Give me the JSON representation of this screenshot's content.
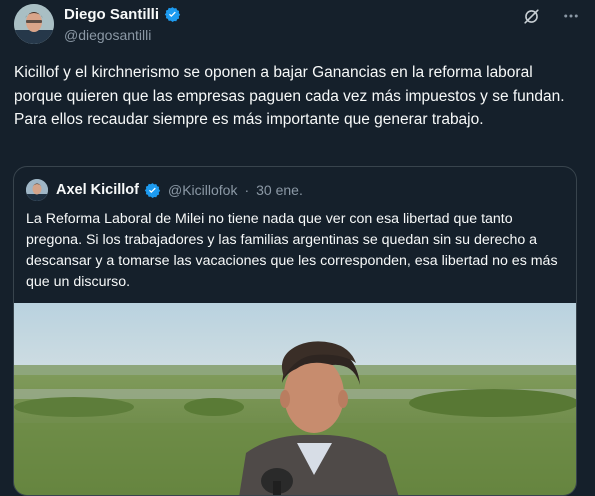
{
  "author": {
    "name": "Diego Santilli",
    "handle": "@diegosantilli"
  },
  "tweet_text": "Kicillof y el kirchnerismo se oponen a bajar Ganancias en la reforma laboral porque quieren que las empresas paguen cada vez más impuestos y se fundan. Para ellos recaudar siempre es más importante que generar trabajo.",
  "quoted": {
    "name": "Axel Kicillof",
    "handle": "@Kicillofok",
    "separator": "·",
    "date": "30 ene.",
    "text": "La Reforma Laboral de Milei no tiene nada que ver con esa libertad que tanto pregona. Si los trabajadores y las familias argentinas se quedan sin su derecho a descansar y a tomarse las vacaciones que les corresponden, esa libertad no es más que un discurso."
  },
  "icons": {
    "verified": "verified-badge-icon",
    "grok": "grok-icon",
    "more": "more-icon"
  },
  "colors": {
    "background": "#15202b",
    "text": "#f7f9f9",
    "secondary": "#8b98a5",
    "verified": "#1d9bf0",
    "border": "#38444d"
  }
}
